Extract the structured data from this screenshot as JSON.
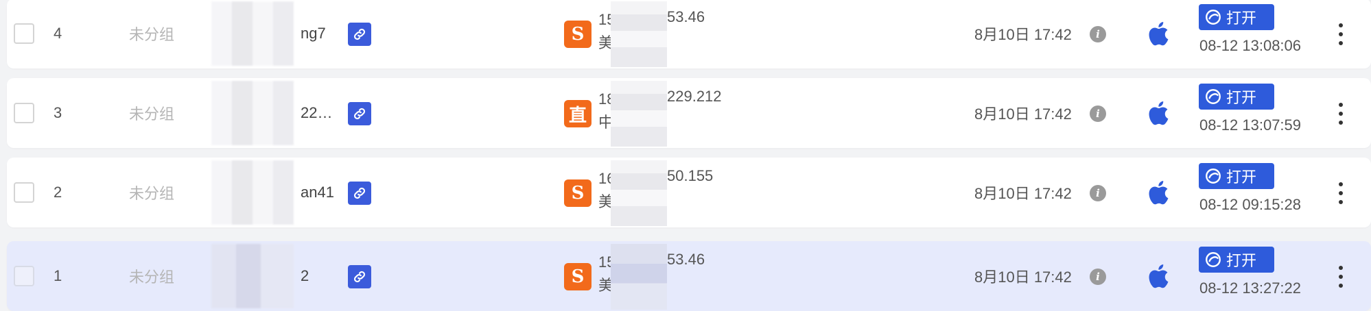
{
  "table": {
    "rows": [
      {
        "index": "4",
        "group": "未分组",
        "name_suffix": "ng7",
        "source_badge": "S",
        "ip_head": "15",
        "ip_tail": "53.46",
        "location": "美",
        "date": "8月10日 17:42",
        "open_label": "打开",
        "open_time": "08-12 13:08:06",
        "selected": false
      },
      {
        "index": "3",
        "group": "未分组",
        "name_suffix": "22…",
        "source_badge": "直",
        "ip_head": "18",
        "ip_tail": "229.212",
        "location": "中",
        "date": "8月10日 17:42",
        "open_label": "打开",
        "open_time": "08-12 13:07:59",
        "selected": false
      },
      {
        "index": "2",
        "group": "未分组",
        "name_suffix": "an41",
        "source_badge": "S",
        "ip_head": "16",
        "ip_tail": "50.155",
        "location": "美",
        "date": "8月10日 17:42",
        "open_label": "打开",
        "open_time": "08-12 09:15:28",
        "selected": false
      },
      {
        "index": "1",
        "group": "未分组",
        "name_suffix": "2",
        "source_badge": "S",
        "ip_head": "15",
        "ip_tail": "53.46",
        "location": "美",
        "date": "8月10日 17:42",
        "open_label": "打开",
        "open_time": "08-12 13:27:22",
        "selected": true
      }
    ]
  },
  "icons": {
    "link": "link-icon",
    "info": "info-icon",
    "os": "apple-icon",
    "open": "browser-open-icon",
    "more": "more-vertical-icon"
  },
  "colors": {
    "accent": "#2e5bdb",
    "source_badge": "#f26a1b",
    "selected_row": "#e6eafc"
  }
}
